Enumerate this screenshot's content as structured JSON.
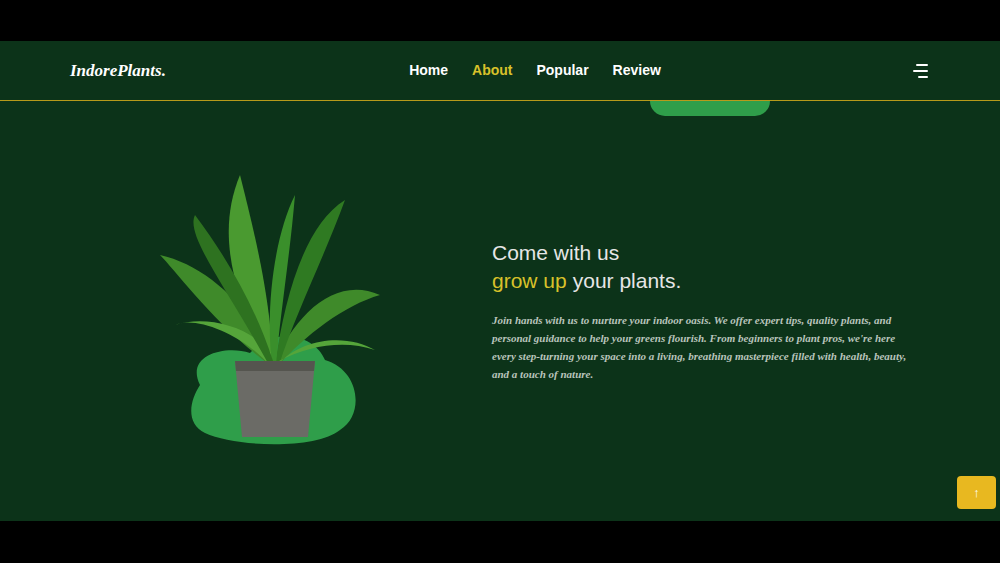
{
  "logo": "IndorePlants.",
  "nav": [
    {
      "label": "Home",
      "selected": false
    },
    {
      "label": "About",
      "selected": true
    },
    {
      "label": "Popular",
      "selected": false
    },
    {
      "label": "Review",
      "selected": false
    }
  ],
  "hero": {
    "line1": "Come with us",
    "highlight": "grow up",
    "rest": "your plants.",
    "paragraph": "Join hands with us to nurture your indoor oasis. We offer expert tips, quality plants, and personal guidance to help your greens flourish. From beginners to plant pros, we're here every step-turning your space into a living, breathing masterpiece filled with health, beauty, and a touch of nature."
  },
  "scroll_top": {
    "label": "↑"
  }
}
